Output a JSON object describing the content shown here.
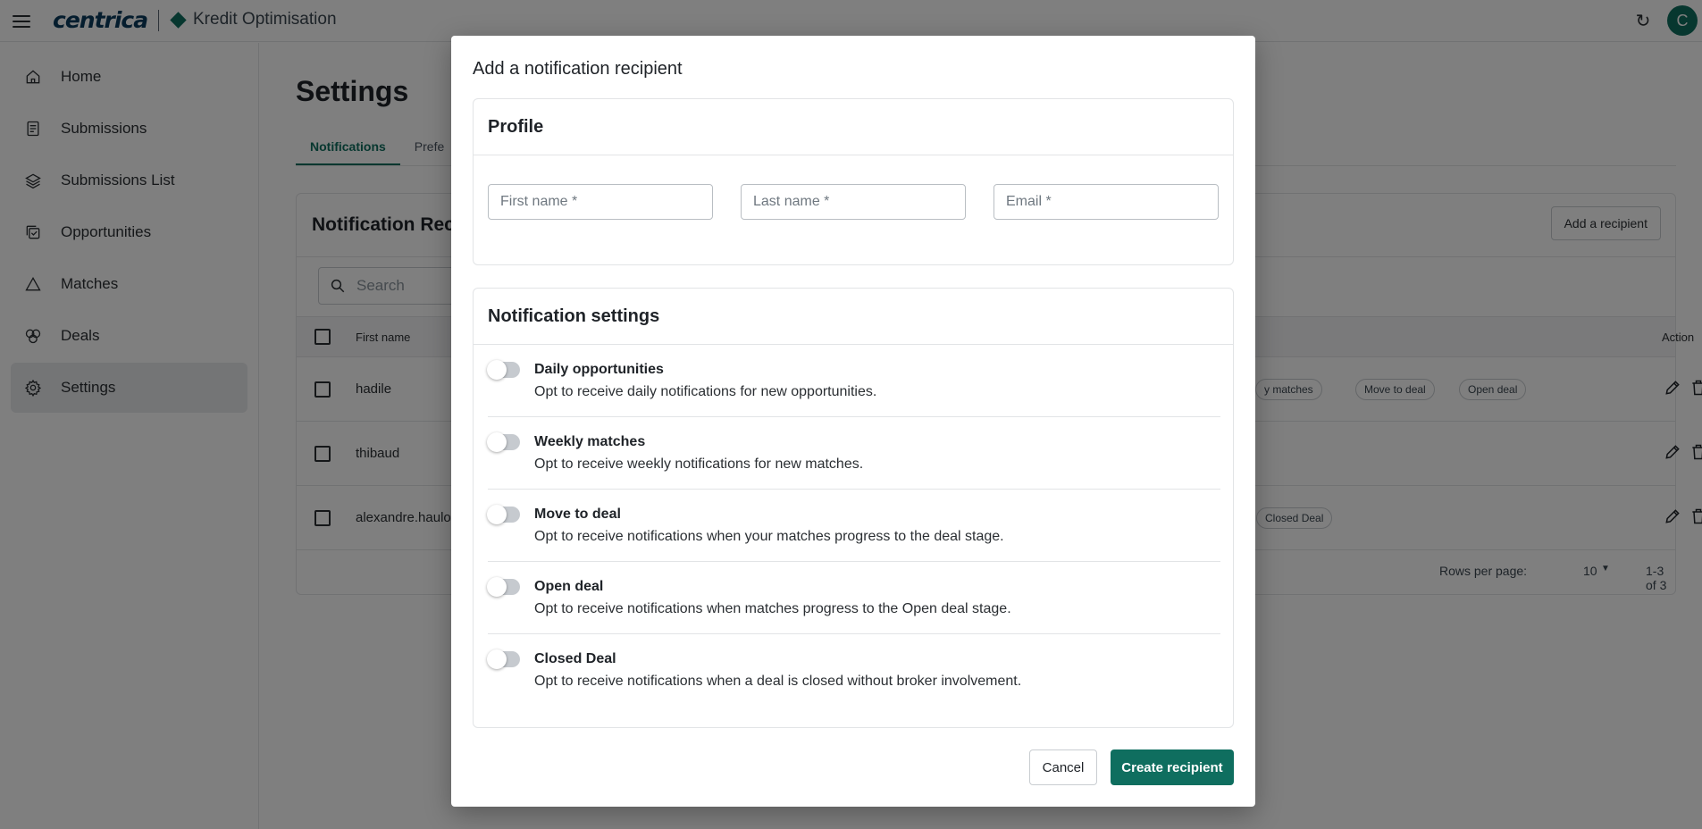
{
  "topbar": {
    "brand": "centrica",
    "product": "Kredit Optimisation",
    "avatar_initial": "C",
    "icons": [
      "menu-icon",
      "diamond-logo-icon",
      "refresh-icon"
    ]
  },
  "sidebar": {
    "items": [
      {
        "label": "Home",
        "icon": "home-icon"
      },
      {
        "label": "Submissions",
        "icon": "document-icon"
      },
      {
        "label": "Submissions List",
        "icon": "layers-icon"
      },
      {
        "label": "Opportunities",
        "icon": "opportunities-icon"
      },
      {
        "label": "Matches",
        "icon": "triangle-icon"
      },
      {
        "label": "Deals",
        "icon": "deals-icon"
      },
      {
        "label": "Settings",
        "icon": "gear-icon",
        "active": true
      }
    ]
  },
  "page": {
    "title": "Settings",
    "tabs": [
      "Notifications",
      "Prefe"
    ],
    "card": {
      "title": "Notification Reci",
      "add_button": "Add a recipient",
      "search_placeholder": "Search",
      "columns": {
        "first_name": "First name",
        "action": "Action"
      },
      "rows": [
        {
          "first_name": "hadile",
          "chips": [
            "y matches",
            "Move to deal",
            "Open deal"
          ]
        },
        {
          "first_name": "thibaud",
          "chips": []
        },
        {
          "first_name": "alexandre.haulot",
          "chips": [
            "Closed Deal"
          ]
        }
      ],
      "footer": {
        "rows_per_page_label": "Rows per page:",
        "rows_per_page_value": "10",
        "range": "1-3 of 3"
      }
    }
  },
  "dialog": {
    "title": "Add a notification recipient",
    "profile": {
      "title": "Profile",
      "first_name_placeholder": "First name *",
      "last_name_placeholder": "Last name *",
      "email_placeholder": "Email *"
    },
    "notification_settings": {
      "title": "Notification settings",
      "options": [
        {
          "label": "Daily opportunities",
          "description": "Opt to receive daily notifications for new opportunities.",
          "enabled": false
        },
        {
          "label": "Weekly matches",
          "description": "Opt to receive weekly notifications for new matches.",
          "enabled": false
        },
        {
          "label": "Move to deal",
          "description": "Opt to receive notifications when your matches progress to the deal stage.",
          "enabled": false
        },
        {
          "label": "Open deal",
          "description": "Opt to receive notifications when matches progress to the Open deal stage.",
          "enabled": false
        },
        {
          "label": "Closed Deal",
          "description": "Opt to receive notifications when a deal is closed without broker involvement.",
          "enabled": false
        }
      ]
    },
    "cancel_label": "Cancel",
    "create_label": "Create recipient"
  },
  "colors": {
    "accent": "#0f6e5f",
    "overlay": "rgba(0,0,0,0.5)",
    "brand": "#0b3b5c"
  }
}
